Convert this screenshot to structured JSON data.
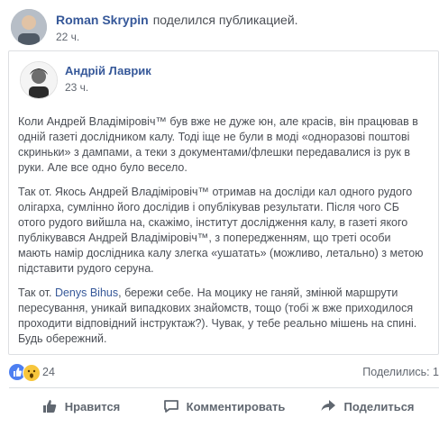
{
  "outer": {
    "author": "Roman Skrypin",
    "shared_text": "поделился публикацией.",
    "time": "22 ч."
  },
  "inner": {
    "author": "Андрій Лаврик",
    "time": "23 ч.",
    "paragraphs": [
      "Коли Андрей Владіміровіч™ був вже не дуже юн, але красів, він працював в одній газеті дослідником калу. Тоді іще не були в моді «одноразові поштові скриньки» з дампами, а теки з документами/флешки передавалися із рук в руки. Але все одно було весело.",
      "Так от. Якось Андрей Владіміровіч™ отримав на досліди кал одного рудого олігарха, сумлінно його дослідив і опублікував результати. Після чого СБ отого рудого вийшла на, скажімо, інститут дослідження калу, в газеті якого публікувався Андрей Владіміровіч™, з попередженням, що треті особи мають намір дослідника калу злегка «ушатать» (можливо, летально) з метою підставити рудого серуна."
    ],
    "p3_before": "Так от. ",
    "p3_mention": "Denys Bihus",
    "p3_after": ", бережи себе. На моцику не ганяй, змінюй маршрути пересування, уникай випадкових знайомств, тощо (тобі ж вже приходилося проходити відповідний інструктаж?). Чувак, у тебе реально мішень на спині. Будь обережний."
  },
  "reactions": {
    "count": "24",
    "shares": "Поделились: 1",
    "like_color": "#4d7ff1",
    "wow_color": "#f7c63c"
  },
  "actions": {
    "like": "Нравится",
    "comment": "Комментировать",
    "share": "Поделиться"
  }
}
